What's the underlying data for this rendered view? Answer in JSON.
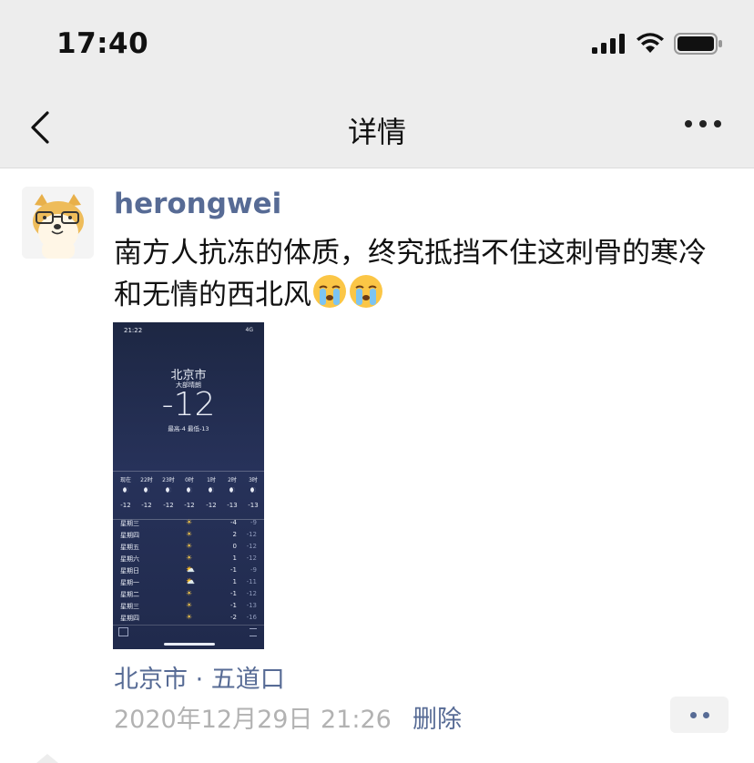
{
  "status_bar": {
    "time": "17:40"
  },
  "nav": {
    "title": "详情"
  },
  "post": {
    "username": "herongwei",
    "text": "南方人抗冻的体质，终究抵挡不住这刺骨的寒冷和无情的西北风",
    "emoji_count": 2,
    "location": "北京市 · 五道口",
    "timestamp": "2020年12月29日 21:26",
    "delete_label": "删除"
  },
  "photo": {
    "phone_time": "21:22",
    "signal": "4G",
    "city": "北京市",
    "condition": "大部晴朗",
    "temperature": "-12",
    "hi_lo": "最高-4  最低-13",
    "hourly": [
      {
        "hour": "现在",
        "temp": "-12"
      },
      {
        "hour": "22时",
        "temp": "-12"
      },
      {
        "hour": "23时",
        "temp": "-12"
      },
      {
        "hour": "0时",
        "temp": "-12"
      },
      {
        "hour": "1时",
        "temp": "-12"
      },
      {
        "hour": "2时",
        "temp": "-13"
      },
      {
        "hour": "3时",
        "temp": "-13"
      }
    ],
    "daily": [
      {
        "day": "星期三",
        "icon": "sun",
        "hi": "-4",
        "lo": "-9"
      },
      {
        "day": "星期四",
        "icon": "sun",
        "hi": "2",
        "lo": "-12"
      },
      {
        "day": "星期五",
        "icon": "sun",
        "hi": "0",
        "lo": "-12"
      },
      {
        "day": "星期六",
        "icon": "sun",
        "hi": "1",
        "lo": "-12"
      },
      {
        "day": "星期日",
        "icon": "partly-cloudy",
        "hi": "-1",
        "lo": "-9"
      },
      {
        "day": "星期一",
        "icon": "partly-cloudy",
        "hi": "1",
        "lo": "-11"
      },
      {
        "day": "星期二",
        "icon": "sun",
        "hi": "-1",
        "lo": "-12"
      },
      {
        "day": "星期三",
        "icon": "sun",
        "hi": "-1",
        "lo": "-13"
      },
      {
        "day": "星期四",
        "icon": "sun",
        "hi": "-2",
        "lo": "-16"
      }
    ]
  },
  "colors": {
    "link": "#576b95",
    "bar_bg": "#ededed",
    "timestamp": "#b2b2b2"
  }
}
